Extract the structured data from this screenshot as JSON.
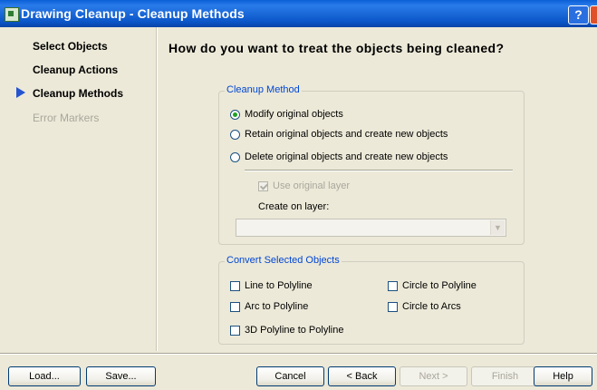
{
  "window": {
    "title": "Drawing Cleanup - Cleanup Methods",
    "help_label": "?"
  },
  "sidebar": {
    "steps": [
      {
        "label": "Select Objects"
      },
      {
        "label": "Cleanup Actions"
      },
      {
        "label": "Cleanup Methods",
        "current": true
      },
      {
        "label": "Error Markers",
        "disabled": true
      }
    ]
  },
  "main": {
    "question": "How do you want to treat the objects being cleaned?",
    "cleanup_method": {
      "legend": "Cleanup Method",
      "options": [
        {
          "label": "Modify original objects",
          "selected": true
        },
        {
          "label": "Retain original objects and create new objects"
        },
        {
          "label": "Delete original objects and create new objects"
        }
      ],
      "use_original_layer": "Use original layer",
      "create_on_layer_label": "Create on layer:",
      "create_on_layer_value": ""
    },
    "convert": {
      "legend": "Convert Selected Objects",
      "options": [
        {
          "label": "Line to Polyline"
        },
        {
          "label": "Circle to Polyline"
        },
        {
          "label": "Arc to Polyline"
        },
        {
          "label": "Circle to Arcs"
        },
        {
          "label": "3D Polyline to Polyline"
        }
      ]
    }
  },
  "buttons": {
    "load": "Load...",
    "save": "Save...",
    "cancel": "Cancel",
    "back": "< Back",
    "next": "Next >",
    "finish": "Finish",
    "help": "Help"
  }
}
